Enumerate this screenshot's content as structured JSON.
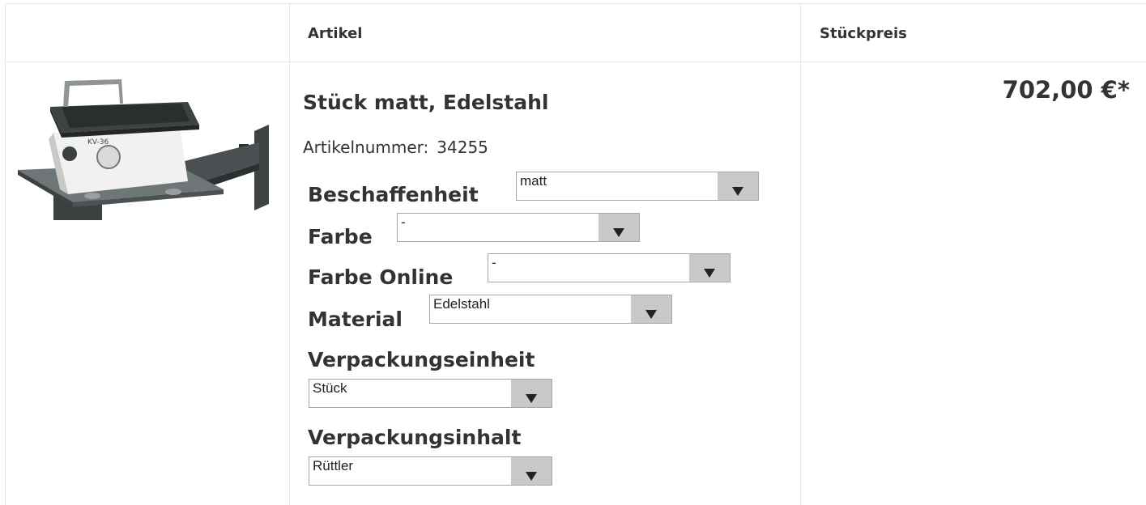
{
  "header": {
    "col_article": "Artikel",
    "col_unit_price": "Stückpreis"
  },
  "product": {
    "title": "Stück matt, Edelstahl",
    "article_number_label": "Artikelnummer:",
    "article_number": "34255",
    "price": "702,00 €*",
    "image": "vibrator-with-wall-bracket-image"
  },
  "options": {
    "beschaffenheit": {
      "label": "Beschaffenheit",
      "value": "matt"
    },
    "farbe": {
      "label": "Farbe",
      "value": "-"
    },
    "farbe_online": {
      "label": "Farbe Online",
      "value": "-"
    },
    "material": {
      "label": "Material",
      "value": "Edelstahl"
    },
    "verpackungseinheit": {
      "label": "Verpackungseinheit",
      "value": "Stück"
    },
    "verpackungsinhalt": {
      "label": "Verpackungsinhalt",
      "value": "Rüttler"
    }
  },
  "icons": {
    "dropdown": "triangle-down-icon"
  },
  "colors": {
    "border": "#e6e6e6",
    "text": "#333333",
    "select_button": "#c9c9c9"
  }
}
